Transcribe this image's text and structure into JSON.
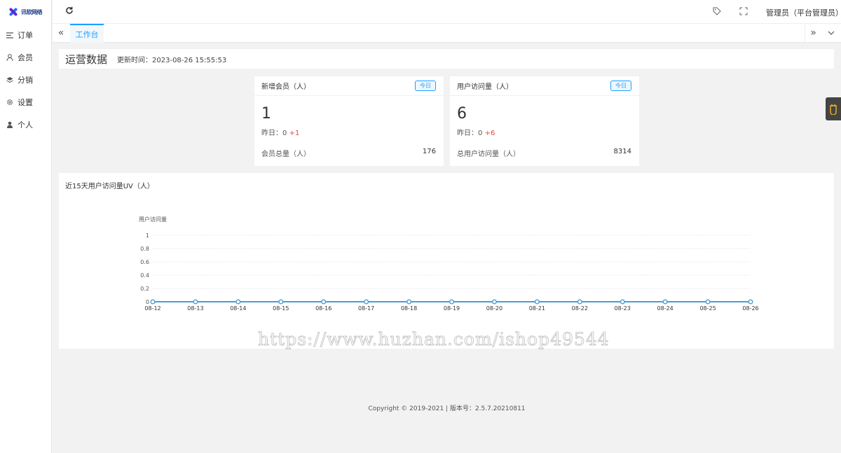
{
  "logo": {
    "text": "讯软网络",
    "icon": "logo-x-icon"
  },
  "sidebar": {
    "items": [
      {
        "label": "订单",
        "icon": "menu-lines-icon"
      },
      {
        "label": "会员",
        "icon": "user-outline-icon"
      },
      {
        "label": "分销",
        "icon": "layers-icon"
      },
      {
        "label": "设置",
        "icon": "gear-icon"
      },
      {
        "label": "个人",
        "icon": "person-icon"
      }
    ]
  },
  "topbar": {
    "refresh_icon": "refresh-icon",
    "tag_icon": "tag-icon",
    "fullscreen_icon": "fullscreen-icon",
    "user_label": "管理员（平台管理员）"
  },
  "tabs": {
    "items": [
      {
        "label": "工作台",
        "active": true
      }
    ]
  },
  "overview": {
    "title": "运营数据",
    "updated_label": "更新时间：",
    "updated_time": "2023-08-26 15:55:53"
  },
  "cards": [
    {
      "title": "新增会员（人）",
      "badge": "今日",
      "value": "1",
      "yesterday_label": "昨日：",
      "yesterday_value": "0",
      "delta": "+1",
      "total_label": "会员总量（人）",
      "total_value": "176"
    },
    {
      "title": "用户访问量（人）",
      "badge": "今日",
      "value": "6",
      "yesterday_label": "昨日：",
      "yesterday_value": "0",
      "delta": "+6",
      "total_label": "总用户访问量（人）",
      "total_value": "8314"
    }
  ],
  "watermark": "https://www.huzhan.com/ishop49544",
  "footer": {
    "text": "Copyright © 2019-2021   |  版本号：2.5.7.20210811"
  },
  "colors": {
    "accent": "#1e9fff",
    "line": "#4a9fd5",
    "delta": "#e54545"
  },
  "chart_data": {
    "type": "line",
    "title": "近15天用户访问量UV（人）",
    "ylabel": "用户访问量",
    "xlabel": "",
    "categories": [
      "08-12",
      "08-13",
      "08-14",
      "08-15",
      "08-16",
      "08-17",
      "08-18",
      "08-19",
      "08-20",
      "08-21",
      "08-22",
      "08-23",
      "08-24",
      "08-25",
      "08-26"
    ],
    "series": [
      {
        "values": [
          0,
          0,
          0,
          0,
          0,
          0,
          0,
          0,
          0,
          0,
          0,
          0,
          0,
          0,
          0
        ]
      }
    ],
    "yticks": [
      "0",
      "0.2",
      "0.4",
      "0.6",
      "0.8",
      "1"
    ],
    "ylim": [
      0,
      1
    ],
    "grid": true
  }
}
